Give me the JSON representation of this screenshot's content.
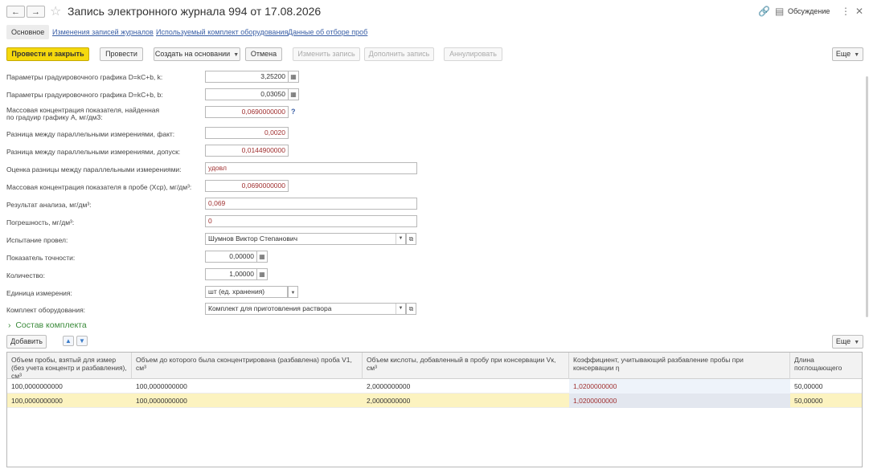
{
  "header": {
    "title": "Запись электронного журнала 994 от 17.08.2026",
    "discussion": "Обсуждение"
  },
  "tabs": [
    {
      "label": "Основное"
    },
    {
      "label": "Изменения записей журналов"
    },
    {
      "label": "Используемый комплект оборудования"
    },
    {
      "label": "Данные об отборе проб"
    }
  ],
  "toolbar": {
    "post_close": "Провести и закрыть",
    "post": "Провести",
    "create_based": "Создать на основании",
    "cancel": "Отмена",
    "edit_record": "Изменить запись",
    "supplement": "Дополнить запись",
    "annul": "Аннулировать",
    "more": "Еще"
  },
  "form": {
    "k_label": "Параметры градуировочного графика D=kC+b, k:",
    "k_value": "3,25200",
    "b_label": "Параметры градуировочного графика D=kC+b, b:",
    "b_value": "0,03050",
    "mass_conc_label_1": "Массовая концентрация показателя, найденная",
    "mass_conc_label_2": "по градуир графику А, мг/дм3:",
    "mass_conc_value": "0,0690000000",
    "help": "?",
    "diff_fact_label": "Разница между параллельными измерениями, факт:",
    "diff_fact_value": "0,0020",
    "diff_tol_label": "Разница между параллельными измерениями, допуск:",
    "diff_tol_value": "0,0144900000",
    "eval_label": "Оценка разницы между параллельными измерениями:",
    "eval_value": "удовл",
    "mass_sample_label": "Массовая концентрация показателя в пробе (Хср), мг/дм³:",
    "mass_sample_value": "0,0690000000",
    "result_label": "Результат анализа, мг/дм³:",
    "result_value": "0,069",
    "error_label": "Погрешность, мг/дм³:",
    "error_value": "0",
    "tester_label": "Испытание провел:",
    "tester_value": "Шумнов Виктор Степанович",
    "accuracy_label": "Показатель точности:",
    "accuracy_value": "0,00000",
    "quantity_label": "Количество:",
    "quantity_value": "1,00000",
    "unit_label": "Единица измерения:",
    "unit_value": "шт (ед. хранения)",
    "kit_label": "Комплект оборудования:",
    "kit_value": "Комплект для приготовления раствора"
  },
  "kit_section": {
    "title": "Состав комплекта",
    "add": "Добавить",
    "more": "Еще",
    "up_icon": "arrow-up-icon",
    "down_icon": "arrow-down-icon"
  },
  "table": {
    "headers": [
      "Объем пробы, взятый для измер (без учета концентр и разбавления), см³",
      "Объем до которого была сконцентрирована (разбавлена) проба V1, см³",
      "Объем кислоты, добавленный в пробу при консервации Vк, см³",
      "Коэффициент, учитывающий разбавление пробы при консервации η",
      "Длина поглощающего"
    ],
    "rows": [
      [
        "100,0000000000",
        "100,0000000000",
        "2,0000000000",
        "1,0200000000",
        "50,00000"
      ],
      [
        "100,0000000000",
        "100,0000000000",
        "2,0000000000",
        "1,0200000000",
        "50,00000"
      ]
    ]
  },
  "colors": {
    "primary_button": "#f5d90d",
    "link": "#3a5fa6",
    "section": "#3a8a3a",
    "selected_row": "#fcf3c0"
  }
}
